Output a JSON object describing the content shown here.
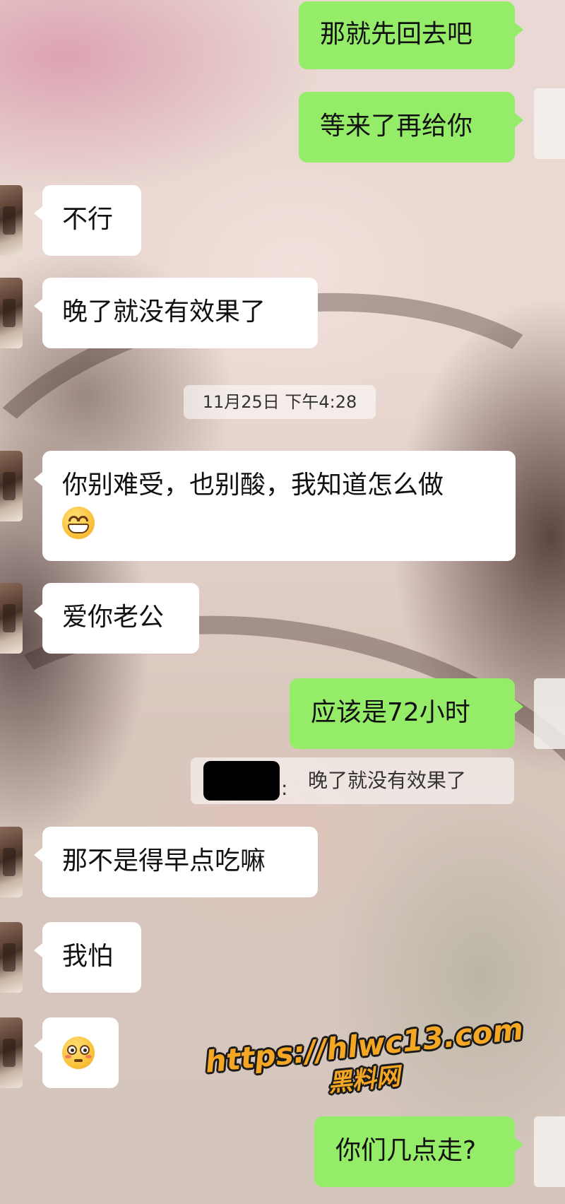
{
  "colors": {
    "sent_bubble": "#95ec69",
    "received_bubble": "#ffffff",
    "watermark": "#f5a623"
  },
  "messages": [
    {
      "side": "right",
      "text": "那就先回去吧"
    },
    {
      "side": "right",
      "text": "等来了再给你"
    },
    {
      "side": "left",
      "text": "不行"
    },
    {
      "side": "left",
      "text": "晚了就没有效果了"
    },
    {
      "side": "left",
      "text": "你别难受，也别酸，我知道怎么做",
      "emoji": "grinning-face-icon"
    },
    {
      "side": "left",
      "text": "爱你老公"
    },
    {
      "side": "right",
      "text": "应该是72小时"
    },
    {
      "side": "left",
      "text": "那不是得早点吃嘛"
    },
    {
      "side": "left",
      "text": "我怕"
    },
    {
      "side": "left",
      "text": "",
      "emoji": "flushed-face-icon"
    },
    {
      "side": "right",
      "text": "你们几点走?"
    }
  ],
  "timestamp": "11月25日 下午4:28",
  "quote": {
    "text": "晚了就没有效果了",
    "visible_sender_tail": ":"
  },
  "watermark": {
    "url": "https://hlwc13.com",
    "name": "黑料网"
  }
}
